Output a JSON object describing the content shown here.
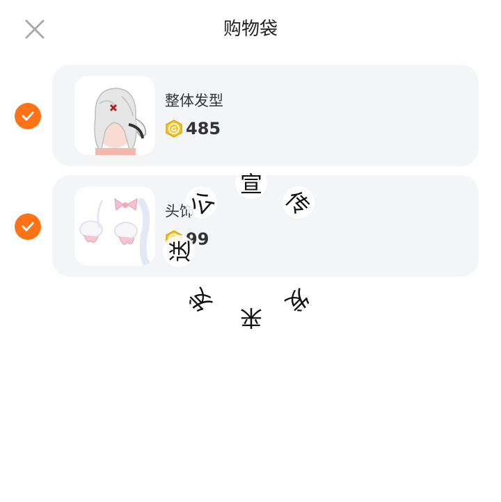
{
  "header": {
    "title": "购物袋",
    "close_icon": "close-icon"
  },
  "items": [
    {
      "name": "整体发型",
      "price": "485",
      "checked": true,
      "thumb_icon": "hairstyle-thumbnail"
    },
    {
      "name": "头饰",
      "price": "99",
      "checked": true,
      "thumb_icon": "headwear-thumbnail"
    }
  ],
  "overlay_characters": [
    "宣",
    "传",
    "发",
    "来",
    "发",
    "送",
    "公"
  ],
  "colors": {
    "accent": "#ff7216",
    "card_bg": "#f4f5f7",
    "coin": "#f7c21a"
  }
}
